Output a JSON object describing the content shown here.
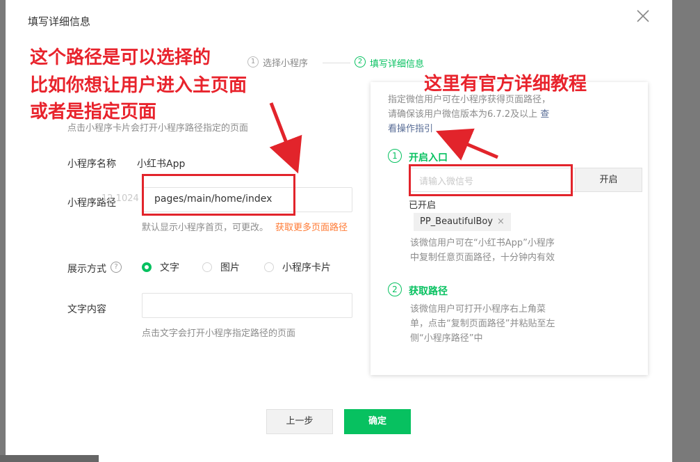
{
  "dialog": {
    "title": "填写详细信息"
  },
  "steps": [
    {
      "num": "1",
      "label": "选择小程序"
    },
    {
      "num": "2",
      "label": "填写详细信息"
    }
  ],
  "form": {
    "card_hint": "点击小程序卡片会打开小程序路径指定的页面",
    "name_label": "小程序名称",
    "name_value": "小红书App",
    "path_label": "小程序路径",
    "path_ghost": "12.1024",
    "path_value": "pages/main/home/index",
    "path_hint": "默认显示小程序首页，可更改。",
    "path_link": "获取更多页面路径",
    "display_label": "展示方式",
    "help_icon_glyph": "?",
    "display_options": [
      "文字",
      "图片",
      "小程序卡片"
    ],
    "display_selected": "文字",
    "text_label": "文字内容",
    "text_value": "",
    "text_hint": "点击文字会打开小程序指定路径的页面"
  },
  "panel": {
    "intro_line1": "指定微信用户可在小程序获得页面路径，",
    "intro_line2_prefix": "请确保该用户微信版本为6.7.2及以上 ",
    "intro_link_part1": "查",
    "intro_link_part2": "看操作指引",
    "step1": {
      "num": "1",
      "title": "开启入口"
    },
    "wechat_input_placeholder": "请输入微信号",
    "enable_button": "开启",
    "enabled_label": "已开启",
    "enabled_user": "PP_BeautifulBoy",
    "tag_close_glyph": "×",
    "step1_desc_line1": "该微信用户可在“小红书App”小程序",
    "step1_desc_line2": "中复制任意页面路径，十分钟内有效",
    "step2": {
      "num": "2",
      "title": "获取路径"
    },
    "step2_desc_line1": "该微信用户可打开小程序右上角菜",
    "step2_desc_line2": "单，点击“复制页面路径”并粘贴至左",
    "step2_desc_line3": "侧“小程序路径”中"
  },
  "footer": {
    "prev_button": "上一步",
    "confirm_button": "确定"
  },
  "annotations": {
    "left_line1": "这个路径是可以选择的",
    "left_line2": "比如你想让用户进入主页面",
    "left_line3": "或者是指定页面",
    "right_text": "这里有官方详细教程"
  },
  "colors": {
    "accent": "#07c160",
    "link_orange": "#ff7a34",
    "annotation_red": "#e8232c",
    "link_blue": "#576b95"
  }
}
